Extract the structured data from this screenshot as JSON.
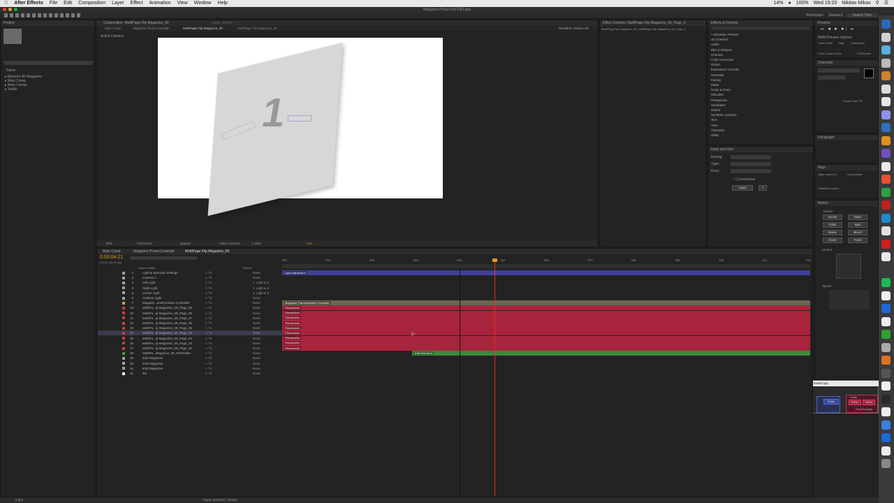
{
  "menubar": {
    "app": "After Effects",
    "items": [
      "File",
      "Edit",
      "Composition",
      "Layer",
      "Effect",
      "Animation",
      "View",
      "Window",
      "Help"
    ],
    "battery": "14%",
    "wifi_pct": "100%",
    "clock": "Wed 19:20",
    "user": "Nikitas Mikas"
  },
  "window_title": "Magazine Promo For E3D.aep",
  "workspace": {
    "label": "Workspace:",
    "value": "Standard",
    "search": "Search Help"
  },
  "project_panel": {
    "tab": "Project",
    "items": [
      "Element 3D Magazine",
      "Main Comp",
      "Main Comps",
      "Solids"
    ],
    "name_header": "Name"
  },
  "composition": {
    "tab": "Composition: MultiPage Flip Magazine_09",
    "layer_tab": "Layer: (none)",
    "breadcrumbs": [
      "Main Comp",
      "Magazine Promo Example",
      "MultiPage Flip Magazine_09",
      "MultiPage Flip Magazine_01"
    ],
    "renderer": "Renderer:  Classic 3D",
    "view_label": "Active Camera",
    "page_number": "1",
    "zoom": "50%",
    "timecode": "0:00:04:21",
    "resolution": "Quarter",
    "camera": "Active Camera",
    "views": "1 View",
    "exposure": "+0.0"
  },
  "effect_controls": {
    "tab": "Effect Controls: MultiPage Flip Magazine_09_Page_0",
    "sub": "MultiPage Flip Magazine_09 • MultiPage Flip Magazine_09_Page_0"
  },
  "effects_presets": {
    "tab": "Effects & Presets",
    "items": [
      "* Animation Presets",
      "3D Channel",
      "Audio",
      "Blur & Sharpen",
      "Channel",
      "Color Correction",
      "Distort",
      "Expression Controls",
      "Generate",
      "Keying",
      "Matte",
      "Noise & Grain",
      "Obsolete",
      "Perspective",
      "Simulation",
      "Stylize",
      "Synthetic Aperture",
      "Text",
      "Time",
      "Transition",
      "Utility"
    ]
  },
  "ease_wizz": {
    "tab": "Ease and wizz",
    "easing": "Easing:",
    "type": "Type:",
    "keys": "Keys:",
    "curvaceous": "Curvaceous",
    "apply": "Apply"
  },
  "preview": {
    "tab": "Preview",
    "ram": "RAM Preview Options",
    "frame_rate": "Frame Rate",
    "skip": "Skip",
    "resolution": "Resolution",
    "from_current": "From Current Time",
    "full_screen": "Full Screen"
  },
  "character": {
    "tab": "Character",
    "stroke": "Stroke Over Fill"
  },
  "paragraph": {
    "tab": "Paragraph"
  },
  "align": {
    "tab": "Align",
    "align_to": "Align Layers to:",
    "align_val": "Composition",
    "distribute": "Distribute Layers:"
  },
  "motion": {
    "tab": "Motion",
    "title": "Motion",
    "buttons": [
      "Excite",
      "Stare",
      "Orbit",
      "Spin",
      "Name",
      "Blend",
      "Clone",
      "Trash"
    ],
    "anchor": "Anchor",
    "speed": "Speed"
  },
  "easecopy": {
    "tab": "EaseCopy",
    "copy": "Copy",
    "paste": "Paste",
    "ease": "Ease",
    "value": "Value",
    "passthrough": "Pass-through"
  },
  "timeline": {
    "tabs": [
      "Main Comp",
      "Magazine Promo Example",
      "MultiPage Flip Magazine_09"
    ],
    "timecode": "0:00:04:21",
    "fps": "00121 (25.00 fps)",
    "col_source": "Source Name",
    "col_parent": "Parent",
    "ticks": [
      "00s",
      "01s",
      "02s",
      "03s",
      "04s",
      "05s",
      "06s",
      "07s",
      "08s",
      "09s",
      "10s",
      "11s",
      "12s"
    ],
    "toggle": "Toggle Switches / Modes",
    "layers": [
      {
        "n": "1",
        "name": "Light & Specular Settings",
        "parent": "None",
        "color": "#a0a0a0",
        "track": "Light Adjustment",
        "kind": "blue"
      },
      {
        "n": "2",
        "name": "Camera 1",
        "parent": "None",
        "color": "#a0a0a0",
        "track": "",
        "kind": "none"
      },
      {
        "n": "3",
        "name": "Left Light",
        "parent": "1. Light & S",
        "color": "#a0a0a0",
        "track": "",
        "kind": "none"
      },
      {
        "n": "4",
        "name": "Right Light",
        "parent": "1. Light & S",
        "color": "#a0a0a0",
        "track": "",
        "kind": "none"
      },
      {
        "n": "5",
        "name": "Center Light",
        "parent": "1. Light & S",
        "color": "#a0a0a0",
        "track": "",
        "kind": "none"
      },
      {
        "n": "6",
        "name": "Ambient Light",
        "parent": "None",
        "color": "#a0a0a0",
        "track": "",
        "kind": "none"
      },
      {
        "n": "7",
        "name": "Magazin...ansformation Controller",
        "parent": "None",
        "color": "#c0a060",
        "track": "Magazine Transformation Controller",
        "kind": "tan"
      },
      {
        "n": "19",
        "name": "MultiPa...ip Magazine_09_Page_09",
        "parent": "None",
        "color": "#c04040",
        "track": "Placeholder",
        "kind": "red"
      },
      {
        "n": "20",
        "name": "MultiPa...ip Magazine_09_Page_08",
        "parent": "None",
        "color": "#c04040",
        "track": "Placeholder",
        "kind": "red"
      },
      {
        "n": "21",
        "name": "MultiPa...ip Magazine_09_Page_07",
        "parent": "None",
        "color": "#c04040",
        "track": "Placeholder",
        "kind": "red"
      },
      {
        "n": "22",
        "name": "MultiPa...ip Magazine_09_Page_06",
        "parent": "None",
        "color": "#c04040",
        "track": "Placeholder",
        "kind": "red"
      },
      {
        "n": "23",
        "name": "MultiPa...ip Magazine_09_Page_05",
        "parent": "None",
        "color": "#c04040",
        "track": "Placeholder",
        "kind": "red"
      },
      {
        "n": "24",
        "name": "MultiPa...ip Magazine_09_Page_04",
        "parent": "None",
        "color": "#c04040",
        "track": "Placeholder",
        "kind": "red"
      },
      {
        "n": "25",
        "name": "MultiPa...ip Magazine_09_Page_03",
        "parent": "None",
        "color": "#c04040",
        "track": "Placeholder",
        "kind": "red"
      },
      {
        "n": "26",
        "name": "MultiPa...ip Magazine_09_Page_02",
        "parent": "None",
        "color": "#c04040",
        "track": "Placeholder",
        "kind": "red"
      },
      {
        "n": "27",
        "name": "MultiPa...ip Magazine_09_Page_01",
        "parent": "None",
        "color": "#c04040",
        "track": "Placeholder",
        "kind": "red"
      },
      {
        "n": "28",
        "name": "MultiPa...Magazine_09_Textholder",
        "parent": "None",
        "color": "#40a040",
        "track": "Edit Text Here",
        "kind": "green"
      },
      {
        "n": "29",
        "name": "E3D Magazine",
        "parent": "None",
        "color": "#a0a0a0",
        "track": "",
        "kind": "none"
      },
      {
        "n": "30",
        "name": "E3D Magazine",
        "parent": "None",
        "color": "#a0a0a0",
        "track": "",
        "kind": "none"
      },
      {
        "n": "31",
        "name": "E3D Magazine",
        "parent": "None",
        "color": "#a0a0a0",
        "track": "",
        "kind": "none"
      },
      {
        "n": "32",
        "name": "BG",
        "parent": "None",
        "color": "#ffffff",
        "track": "",
        "kind": "none"
      }
    ]
  },
  "status": {
    "bpc": "8 bpc"
  },
  "colors": {
    "blue_bar": "#3f3f9a",
    "red_bar": "#a8243c",
    "green_bar": "#3a8a3a",
    "tan_bar": "#6b6550",
    "playhead": "#e03030",
    "timecode": "#e0a020"
  }
}
